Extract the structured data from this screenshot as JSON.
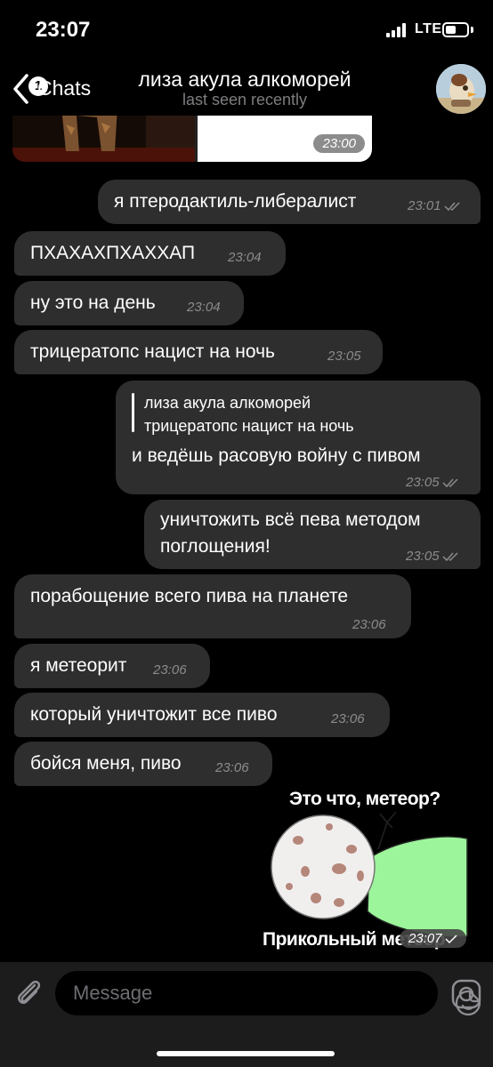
{
  "status_bar": {
    "time": "23:07",
    "network": "LTE"
  },
  "header": {
    "back_label": "Chats",
    "unread_count": "1",
    "title": "лиза акула алкоморей",
    "subtitle": "last seen recently"
  },
  "messages": [
    {
      "type": "photo",
      "time": "23:00"
    },
    {
      "dir": "out",
      "text": "я птеродактиль-либералист",
      "time": "23:01",
      "read": true
    },
    {
      "dir": "in",
      "text": "ПХАХАХПХАХХАП",
      "time": "23:04"
    },
    {
      "dir": "in",
      "text": "ну это на день",
      "time": "23:04"
    },
    {
      "dir": "in",
      "text": "трицератопс нацист на ночь",
      "time": "23:05"
    },
    {
      "dir": "out",
      "reply_author": "лиза акула алкоморей",
      "reply_text": "трицератопс нацист на ночь",
      "text": "и ведёшь расовую войну с пивом",
      "time": "23:05",
      "read": true
    },
    {
      "dir": "out",
      "text_line1": "уничтожить всё пева методом",
      "text_line2": "поглощения!",
      "time": "23:05",
      "read": true
    },
    {
      "dir": "in",
      "text": "порабощение всего пива на планете",
      "time": "23:06"
    },
    {
      "dir": "in",
      "text": "я метеорит",
      "time": "23:06"
    },
    {
      "dir": "in",
      "text": "который уничтожит все пиво",
      "time": "23:06"
    },
    {
      "dir": "in",
      "text": "бойся меня, пиво",
      "time": "23:06"
    },
    {
      "type": "meme",
      "caption_top": "Это что, метеор?",
      "caption_bottom": "Прикольный метеор",
      "time": "23:07",
      "sent": true
    }
  ],
  "input": {
    "placeholder": "Message"
  },
  "icons": {
    "back": "chevron-left-icon",
    "attach": "paperclip-icon",
    "sticker": "sticker-icon",
    "camera": "camera-icon"
  },
  "colors": {
    "background": "#000000",
    "bubble": "#2e2e2e",
    "meteor_leaf": "#9cf59a"
  }
}
